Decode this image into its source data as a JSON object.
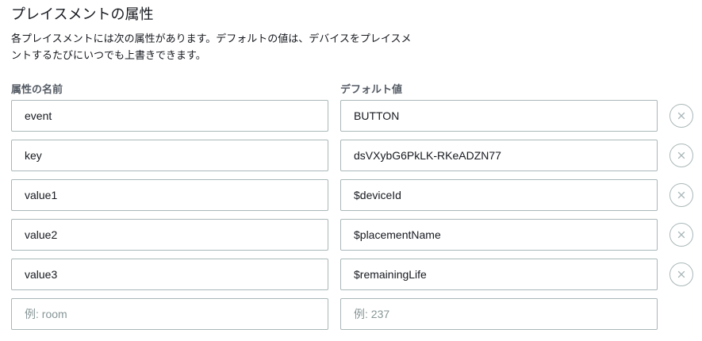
{
  "section": {
    "title": "プレイスメントの属性",
    "description_line1": "各プレイスメントには次の属性があります。デフォルトの値は、デバイスをプレイスメ",
    "description_line2": "ントするたびにいつでも上書きできます。"
  },
  "columns": {
    "name_label": "属性の名前",
    "value_label": "デフォルト値"
  },
  "attributes": [
    {
      "name": "event",
      "value": "BUTTON"
    },
    {
      "name": "key",
      "value": "dsVXybG6PkLK-RKeADZN77"
    },
    {
      "name": "value1",
      "value": "$deviceId"
    },
    {
      "name": "value2",
      "value": "$placementName"
    },
    {
      "name": "value3",
      "value": "$remainingLife"
    }
  ],
  "new_attribute": {
    "name_placeholder": "例: room",
    "value_placeholder": "例: 237"
  },
  "icons": {
    "remove": "close-icon"
  },
  "colors": {
    "border": "#aab7b8",
    "label": "#545b64",
    "text": "#16191f",
    "placeholder": "#879596"
  }
}
